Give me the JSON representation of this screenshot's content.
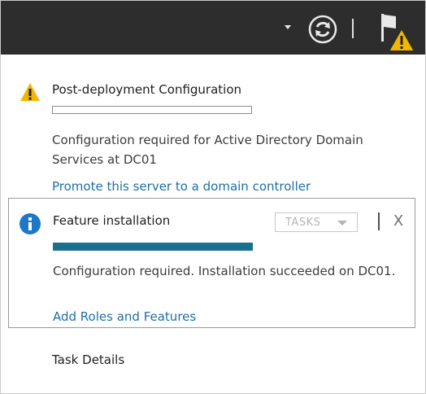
{
  "topbar": {
    "dropdown_icon": "chevron-down-icon",
    "refresh_icon": "refresh-icon",
    "flag_icon": "notification-flag-icon",
    "flag_badge_icon": "warning-badge-icon"
  },
  "notifications": [
    {
      "type": "warning",
      "icon": "warning-icon",
      "title": "Post-deployment Configuration",
      "progress": 0,
      "description": "Configuration required for Active Directory Domain Services at DC01",
      "link": "Promote this server to a domain controller"
    },
    {
      "type": "info",
      "icon": "info-icon",
      "title": "Feature installation",
      "progress": 1.0,
      "description": "Configuration required. Installation succeeded on DC01.",
      "link": "Add Roles and Features",
      "tasks_label": "TASKS",
      "close_label": "X"
    }
  ],
  "footer": {
    "task_details": "Task Details"
  },
  "colors": {
    "topbar": "#2d2d2d",
    "warning": "#f2b600",
    "info": "#1d78c8",
    "progress_fill": "#17708f",
    "link": "#1d6fa5"
  }
}
